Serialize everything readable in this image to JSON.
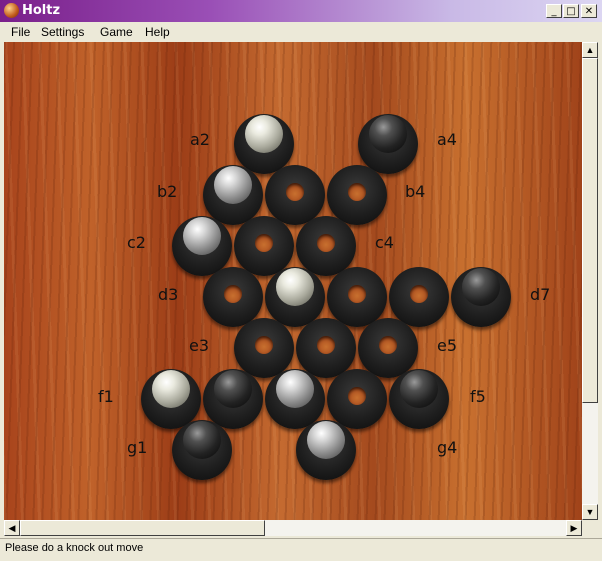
{
  "window": {
    "title": "Holtz"
  },
  "titlebar": {
    "minimize": "_",
    "maximize": "□",
    "close": "✕"
  },
  "menu": [
    "File",
    "Settings",
    "Game",
    "Help"
  ],
  "status": "Please do a knock out move",
  "labels": [
    "a2",
    "a4",
    "b2",
    "b4",
    "c2",
    "c4",
    "d3",
    "d7",
    "e3",
    "e5",
    "f1",
    "f5",
    "g1",
    "g4"
  ],
  "board": {
    "rows": [
      [
        "white",
        null,
        "black"
      ],
      [
        "grey",
        "empty",
        "empty"
      ],
      [
        "grey",
        "empty",
        "empty"
      ],
      [
        "empty",
        "white",
        "empty",
        "empty",
        "black"
      ],
      [
        "empty",
        "empty",
        "empty"
      ],
      [
        "white",
        "black",
        "grey",
        "empty",
        "black"
      ],
      [
        "black",
        null,
        "grey"
      ]
    ]
  },
  "colors": {
    "board_wood": "#b0502a",
    "ring": "#1e1e1e",
    "titlebar": "#7a1f8a"
  }
}
